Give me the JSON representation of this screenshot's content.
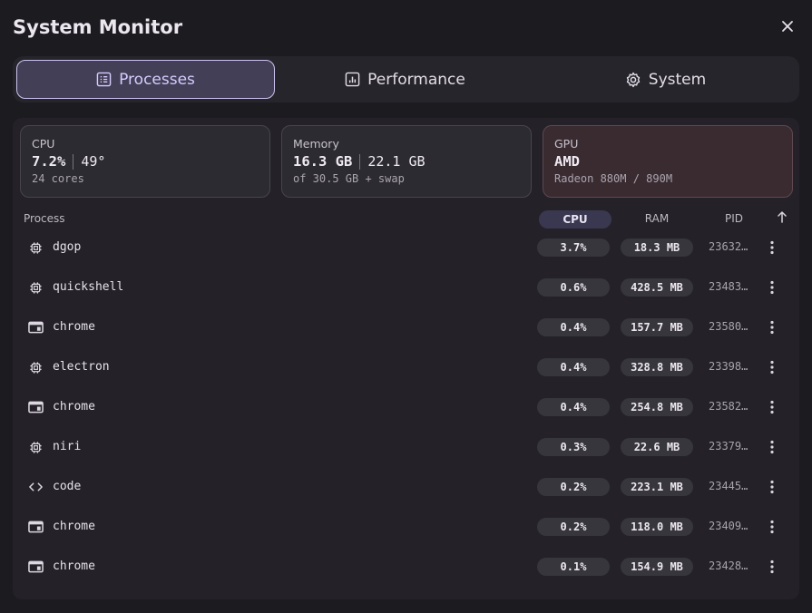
{
  "window": {
    "title": "System Monitor"
  },
  "tabs": [
    {
      "label": "Processes",
      "icon": "list-icon",
      "active": true
    },
    {
      "label": "Performance",
      "icon": "chart-icon",
      "active": false
    },
    {
      "label": "System",
      "icon": "gear-icon",
      "active": false
    }
  ],
  "cards": {
    "cpu": {
      "label": "CPU",
      "value": "7.2%",
      "secondary": "49°",
      "sub": "24 cores"
    },
    "memory": {
      "label": "Memory",
      "value": "16.3 GB",
      "secondary": "22.1 GB",
      "sub": "of 30.5 GB + swap"
    },
    "gpu": {
      "label": "GPU",
      "value": "AMD",
      "sub": "Radeon 880M / 890M"
    }
  },
  "table": {
    "columns": {
      "process": "Process",
      "cpu": "CPU",
      "ram": "RAM",
      "pid": "PID"
    },
    "rows": [
      {
        "icon": "chip-icon",
        "name": "dgop",
        "cpu": "3.7%",
        "ram": "18.3 MB",
        "pid": "23632…"
      },
      {
        "icon": "chip-icon",
        "name": "quickshell",
        "cpu": "0.6%",
        "ram": "428.5 MB",
        "pid": "23483…"
      },
      {
        "icon": "window-icon",
        "name": "chrome",
        "cpu": "0.4%",
        "ram": "157.7 MB",
        "pid": "23580…"
      },
      {
        "icon": "chip-icon",
        "name": "electron",
        "cpu": "0.4%",
        "ram": "328.8 MB",
        "pid": "23398…"
      },
      {
        "icon": "window-icon",
        "name": "chrome",
        "cpu": "0.4%",
        "ram": "254.8 MB",
        "pid": "23582…"
      },
      {
        "icon": "chip-icon",
        "name": "niri",
        "cpu": "0.3%",
        "ram": "22.6 MB",
        "pid": "23379…"
      },
      {
        "icon": "code-icon",
        "name": "code",
        "cpu": "0.2%",
        "ram": "223.1 MB",
        "pid": "23445…"
      },
      {
        "icon": "window-icon",
        "name": "chrome",
        "cpu": "0.2%",
        "ram": "118.0 MB",
        "pid": "23409…"
      },
      {
        "icon": "window-icon",
        "name": "chrome",
        "cpu": "0.1%",
        "ram": "154.9 MB",
        "pid": "23428…"
      }
    ]
  },
  "colors": {
    "accent": "#cbc2ef",
    "tab_active_bg": "#433f56",
    "gpu_card_bg": "#3a2b31"
  }
}
